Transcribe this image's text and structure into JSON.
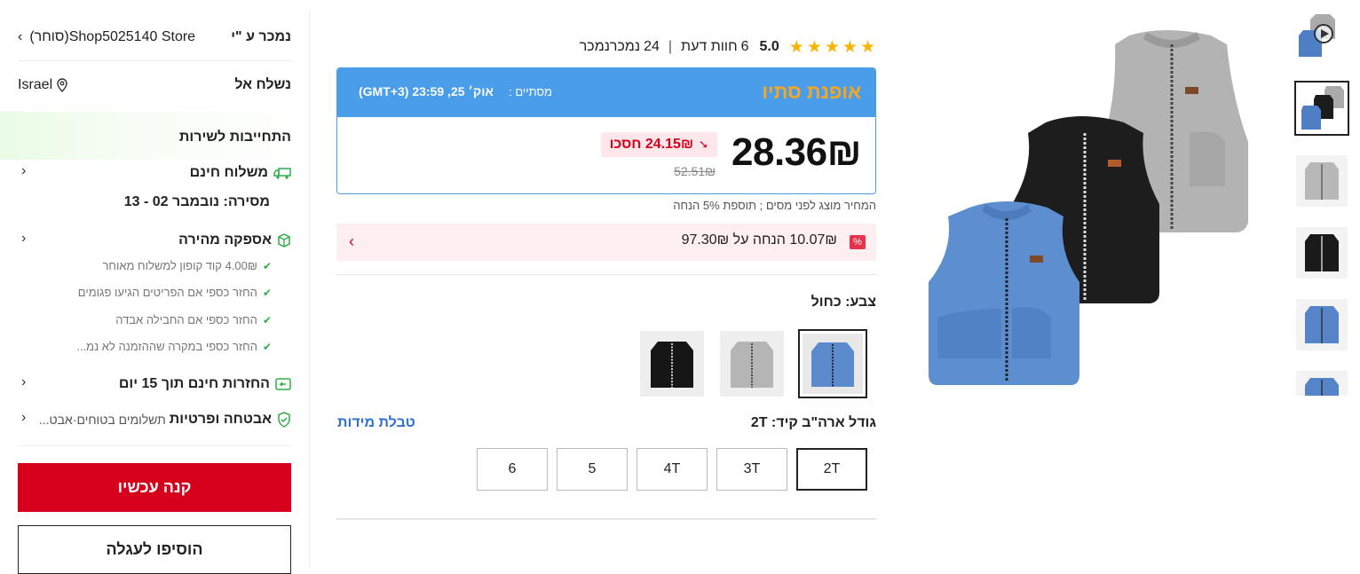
{
  "gallery": {
    "thumbs": [
      "video-thumb",
      "three-vests",
      "gray-vest",
      "black-vest",
      "blue-vest",
      "blue-vest-partial"
    ]
  },
  "rating": {
    "score": "5.0",
    "reviews_count": "6",
    "reviews_label": "חוות דעת",
    "sold_count": "24",
    "sold_label": "נמכרנמכר",
    "separator": "|"
  },
  "flash": {
    "title": "אופנת סתיו",
    "ends_label": "מסתיים :",
    "ends_time": "אוק׳ 25, 23:59 (GMT+3)",
    "price": "28.36₪",
    "save_label": "24.15₪ חסכו",
    "old_price": "52.51₪"
  },
  "tax_note": "המחיר מוצג לפני מסים ; תוספת 5% הנחה",
  "coupon": {
    "badge": "%",
    "text_prefix": "10.07₪",
    "text_suffix": "הנחה על 97.30₪"
  },
  "color": {
    "label": "צבע: כחול",
    "swatches": [
      "blue",
      "gray",
      "black"
    ]
  },
  "size": {
    "label": "גודל ארה\"ב קיד: 2T",
    "guide_link": "טבלת מידות",
    "options": [
      "2T",
      "3T",
      "4T",
      "5",
      "6"
    ],
    "selected": "2T"
  },
  "seller": {
    "label": "נמכר ע \"י",
    "store": "Shop5025140 Store",
    "store_tag": "(סוחר)"
  },
  "ship_to": {
    "label": "נשלח אל",
    "country": "Israel"
  },
  "commitment": {
    "title": "התחייבות לשירות",
    "free_shipping": "משלוח חינם",
    "delivery": "מסירה: נובמבר 02 - 13",
    "fast_delivery": "אספקה מהירה",
    "perks": [
      "4.00₪ קוד קופון למשלוח מאוחר",
      "החזר כספי אם הפריטים הגיעו פגומים",
      "החזר כספי אם החבילה אבדה",
      "החזר כספי במקרה שההזמנה לא נמ..."
    ],
    "returns": "החזרות חינם תוך 15 יום",
    "security": "אבטחה ופרטיות",
    "security_sub": "תשלומים בטוחים·אבט..."
  },
  "actions": {
    "buy_now": "קנה עכשיו",
    "add_to_cart": "הוסיפו לעגלה"
  },
  "colors": {
    "accent_red": "#d6001c",
    "flash_blue": "#4a9de9",
    "flash_title": "#f5a623",
    "check_green": "#2fae45",
    "star": "#f7b500",
    "link_blue": "#2d6fd2"
  }
}
